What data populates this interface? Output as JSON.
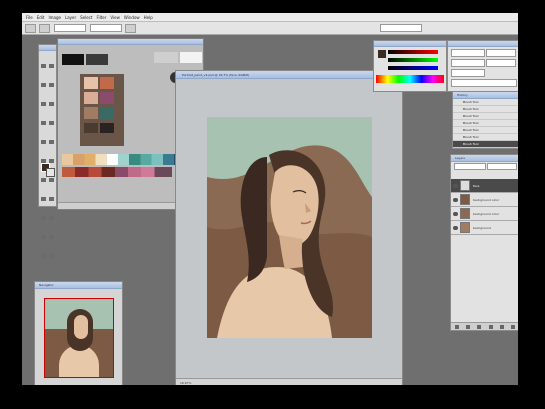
{
  "app": {
    "menu": [
      "File",
      "Edit",
      "Image",
      "Layer",
      "Select",
      "Filter",
      "View",
      "Window",
      "Help"
    ],
    "document_title": "Portrait_paint_v4.psd @ 16.7% (face, RGB/8)",
    "navigator_title": "Navigator",
    "history_title": "History",
    "layers_title": "Layers",
    "zoom_status": "16.67%"
  },
  "history": {
    "items": [
      "Brush Tool",
      "Brush Tool",
      "Brush Tool",
      "Brush Tool",
      "Brush Tool",
      "Brush Tool",
      "Brush Tool"
    ]
  },
  "layers": {
    "items": [
      "face",
      "background color",
      "background color",
      "background"
    ]
  },
  "colors": {
    "bg": "#6f6f6f",
    "painting_bg": "#9cbcac",
    "skin": "#e4c4a4",
    "hair": "#4a3528"
  },
  "icons": [
    "move-icon",
    "marquee-icon",
    "lasso-icon",
    "brush-icon",
    "eraser-icon",
    "zoom-icon",
    "hand-icon"
  ]
}
